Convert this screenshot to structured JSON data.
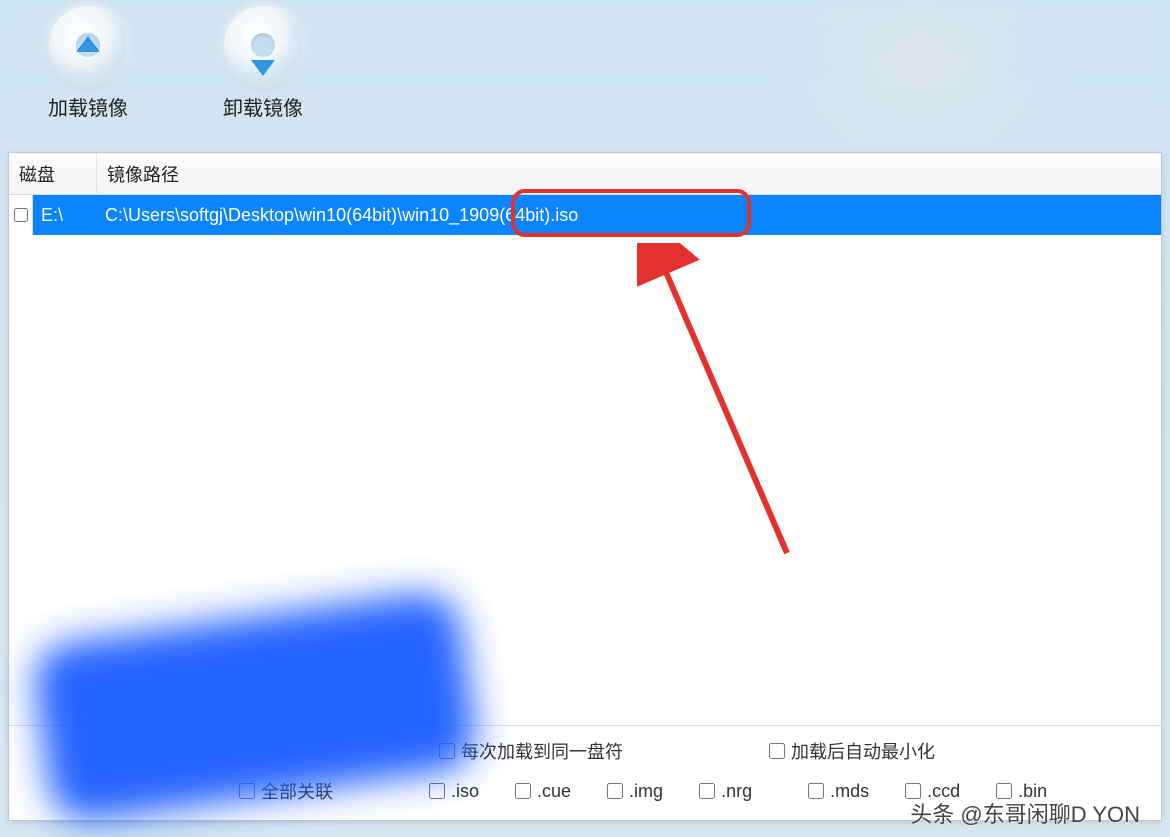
{
  "toolbar": {
    "load_label": "加载镜像",
    "unload_label": "卸载镜像"
  },
  "table": {
    "col_disk": "磁盘",
    "col_path": "镜像路径",
    "rows": [
      {
        "disk": "E:\\",
        "path": "C:\\Users\\softgj\\Desktop\\win10(64bit)\\win10_1909(64bit).iso"
      }
    ]
  },
  "options": {
    "row1": {
      "same_drive": "每次加载到同一盘符",
      "auto_minimize": "加载后自动最小化"
    },
    "row2": {
      "assoc_all": "全部关联",
      "iso": ".iso",
      "cue": ".cue",
      "img": ".img",
      "nrg": ".nrg",
      "mds": ".mds",
      "ccd": ".ccd",
      "bin": ".bin"
    }
  },
  "watermark": "头条 @东哥闲聊D YON"
}
